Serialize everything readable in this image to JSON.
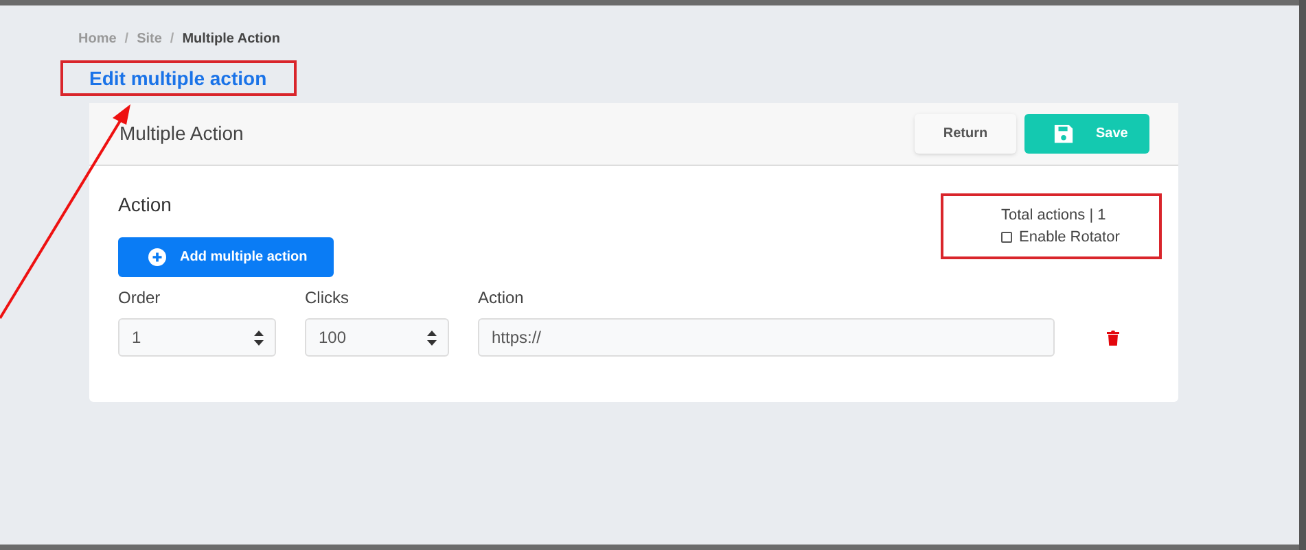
{
  "breadcrumb_separator": "/",
  "breadcrumb": [
    {
      "label": "Home",
      "current": false
    },
    {
      "label": "Site",
      "current": false
    },
    {
      "label": "Multiple Action",
      "current": true
    }
  ],
  "page_title": "Edit multiple action",
  "card": {
    "title": "Multiple Action",
    "buttons": [
      {
        "kind": "return",
        "label": "Return"
      },
      {
        "kind": "save",
        "label": "Save"
      }
    ]
  },
  "section_title": "Action",
  "add_button": "Add multiple action",
  "total_actions": "Total actions | 1",
  "rotator": {
    "label": "Enable Rotator",
    "checked": false
  },
  "columns": [
    "Order",
    "Clicks",
    "Action"
  ],
  "rows": [
    {
      "order": "1",
      "clicks": "100",
      "action": "https://"
    }
  ]
}
